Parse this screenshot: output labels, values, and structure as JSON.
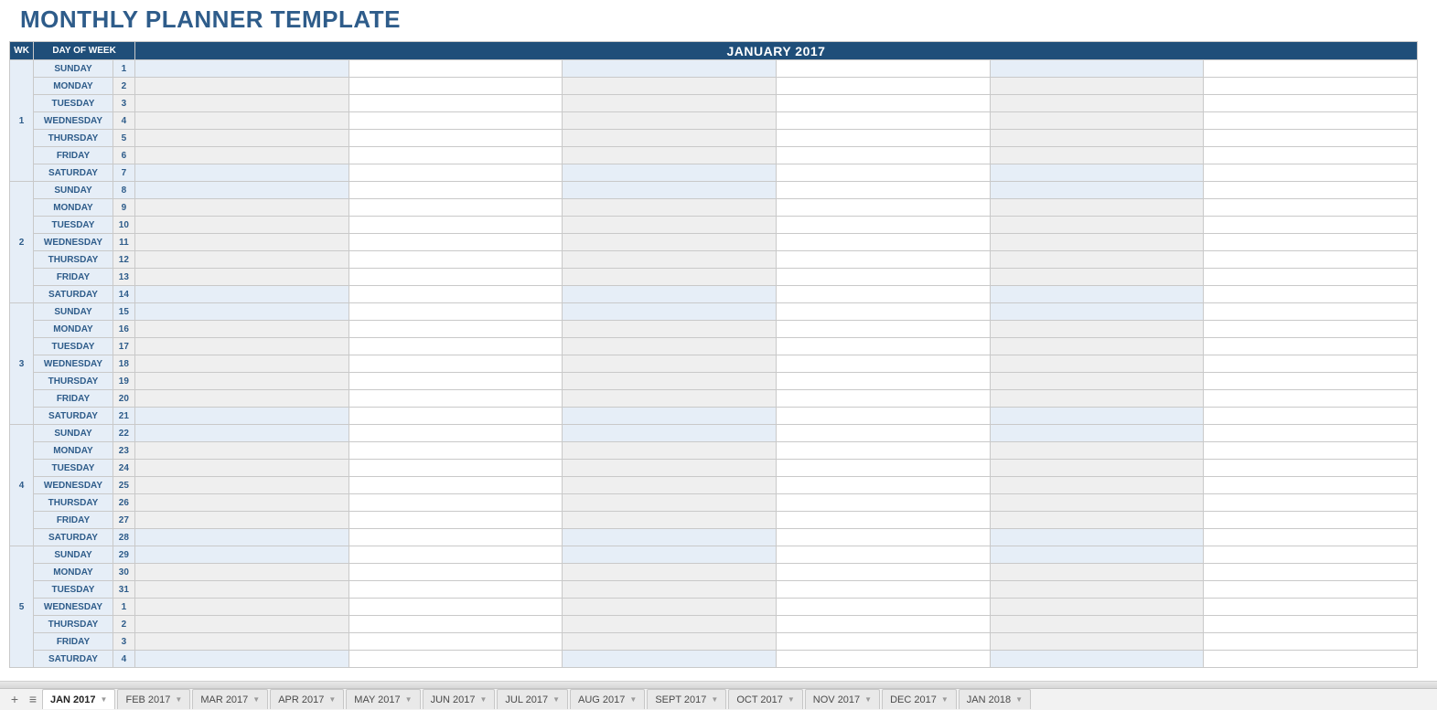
{
  "title": "MONTHLY PLANNER TEMPLATE",
  "header": {
    "wk": "WK",
    "day_of_week": "DAY OF WEEK",
    "month": "JANUARY 2017"
  },
  "days": [
    "SUNDAY",
    "MONDAY",
    "TUESDAY",
    "WEDNESDAY",
    "THURSDAY",
    "FRIDAY",
    "SATURDAY"
  ],
  "weeks": [
    {
      "num": "1",
      "dates": [
        "1",
        "2",
        "3",
        "4",
        "5",
        "6",
        "7"
      ]
    },
    {
      "num": "2",
      "dates": [
        "8",
        "9",
        "10",
        "11",
        "12",
        "13",
        "14"
      ]
    },
    {
      "num": "3",
      "dates": [
        "15",
        "16",
        "17",
        "18",
        "19",
        "20",
        "21"
      ]
    },
    {
      "num": "4",
      "dates": [
        "22",
        "23",
        "24",
        "25",
        "26",
        "27",
        "28"
      ]
    },
    {
      "num": "5",
      "dates": [
        "29",
        "30",
        "31",
        "1",
        "2",
        "3",
        "4"
      ]
    }
  ],
  "entry_columns": 6,
  "tabs": {
    "active": "JAN 2017",
    "list": [
      "JAN 2017",
      "FEB 2017",
      "MAR 2017",
      "APR 2017",
      "MAY 2017",
      "JUN 2017",
      "JUL 2017",
      "AUG 2017",
      "SEPT 2017",
      "OCT 2017",
      "NOV 2017",
      "DEC 2017",
      "JAN 2018"
    ]
  }
}
